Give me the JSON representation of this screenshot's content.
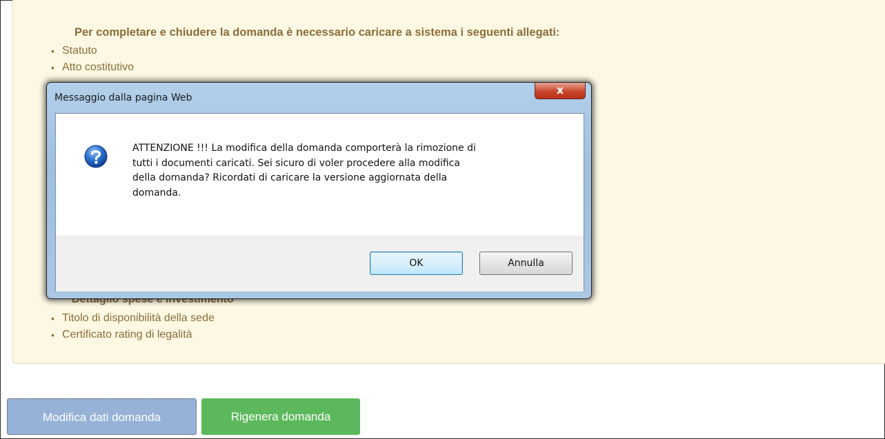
{
  "panel": {
    "heading": "Per completare e chiudere la domanda è necessario caricare a sistema i seguenti allegati:",
    "items_top": [
      "Statuto",
      "Atto costitutivo"
    ],
    "items_bottom": [
      "Titolo di disponibilità della sede",
      "Certificato rating di legalità"
    ],
    "partially_hidden_label": "Dettaglio spese e investimento",
    "bullet": "•"
  },
  "buttons": {
    "modify_label": "Modifica dati domanda",
    "regenerate_label": "Rigenera domanda"
  },
  "dialog": {
    "title": "Messaggio dalla pagina Web",
    "close_symbol": "x",
    "message_lines": [
      "ATTENZIONE !!! La modifica della domanda comporterà la rimozione di",
      "tutti i documenti caricati. Sei sicuro di voler procedere alla modifica",
      "della domanda? Ricordati di caricare la versione aggiornata della",
      "domanda."
    ],
    "ok_label": "OK",
    "cancel_label": "Annulla",
    "icon": "question-icon"
  },
  "colors": {
    "panel_bg": "#fcf8e3",
    "panel_text": "#8a6d3b",
    "primary_button": "#96b2d6",
    "success_button": "#5cb85c"
  }
}
